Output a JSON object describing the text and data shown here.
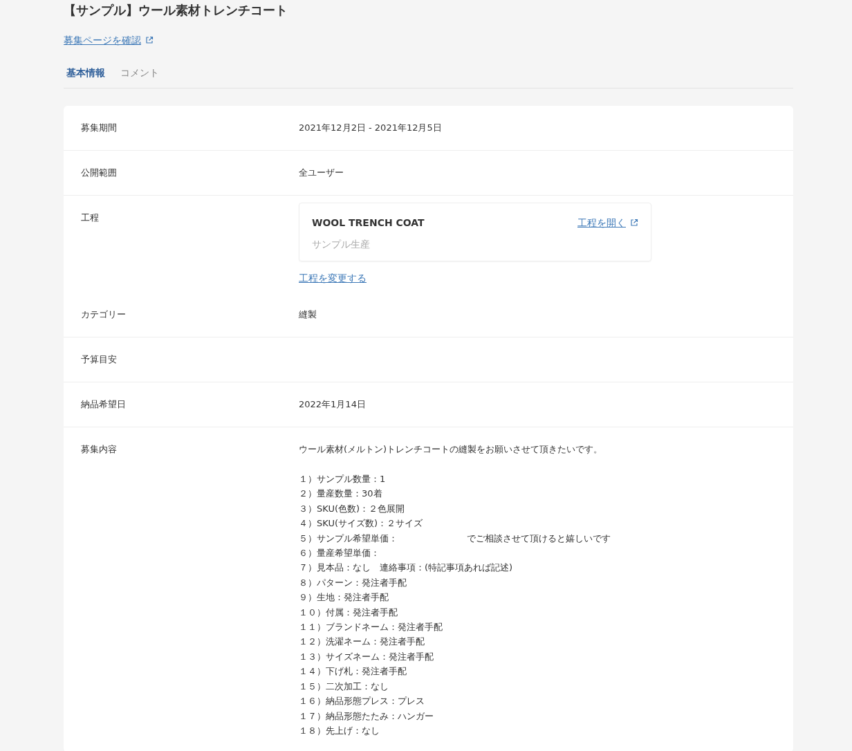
{
  "title": "【サンプル】ウール素材トレンチコート",
  "recruit_link": "募集ページを確認",
  "tabs": [
    {
      "label": "基本情報",
      "selected": true
    },
    {
      "label": "コメント",
      "selected": false
    }
  ],
  "rows": [
    {
      "kind": "text",
      "label": "募集期間",
      "value": "2021年12月2日 - 2021年12月5日"
    },
    {
      "kind": "text",
      "label": "公開範囲",
      "value": "全ユーザー"
    },
    {
      "kind": "process",
      "label": "工程",
      "process": {
        "name": "WOOL TRENCH COAT",
        "type": "サンプル生産",
        "open_link": "工程を開く",
        "change_link": "工程を変更する"
      }
    },
    {
      "kind": "text",
      "label": "カテゴリー",
      "value": "縫製"
    },
    {
      "kind": "empty",
      "label": "予算目安"
    },
    {
      "kind": "text",
      "label": "納品希望日",
      "value": "2022年1月14日"
    },
    {
      "kind": "list",
      "label": "募集内容",
      "intro": "ウール素材(メルトン)トレンチコートの縫製をお願いさせて頂きたいです。",
      "lines": [
        [
          "１）サンプル数量：1"
        ],
        [
          "２）量産数量：30着"
        ],
        [
          "３）SKU(色数)：２色展開"
        ],
        [
          "４）SKU(サイズ数)：２サイズ"
        ],
        [
          "５）サンプル希望単価：",
          "でご相談させて頂けると嬉しいです"
        ],
        [
          "６）量産希望単価："
        ],
        [
          "７）見本品：なし　連絡事項：(特記事項あれば記述)"
        ],
        [
          "８）パターン：発注者手配"
        ],
        [
          "９）生地：発注者手配"
        ],
        [
          "１０）付属：発注者手配"
        ],
        [
          "１１）ブランドネーム：発注者手配"
        ],
        [
          "１２）洗濯ネーム：発注者手配"
        ],
        [
          "１３）サイズネーム：発注者手配"
        ],
        [
          "１４）下げ札：発注者手配"
        ],
        [
          "１５）二次加工：なし"
        ],
        [
          "１６）納品形態プレス：プレス"
        ],
        [
          "１７）納品形態たたみ：ハンガー"
        ],
        [
          "１８）先上げ：なし"
        ]
      ]
    }
  ]
}
